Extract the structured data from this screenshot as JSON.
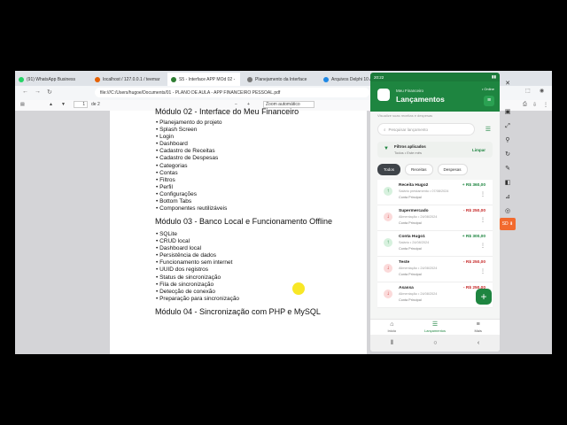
{
  "browser": {
    "tabs": [
      {
        "label": "(91) WhatsApp Business",
        "color": "#25d366"
      },
      {
        "label": "localhost / 127.0.0.1 / teemar",
        "color": "#e66000"
      },
      {
        "label": "S5 - Interface APP MOd 02 -",
        "color": "#2e7d32"
      },
      {
        "label": "Planejamento da Interface",
        "color": "#777777"
      },
      {
        "label": "Arquivos Delphi 10 Avanc",
        "color": "#1e88e5"
      }
    ],
    "url": "file:///C:/Users/hugoe/Documents/01 - PLANO DE AULA - APP FINANCEIRO PESSOAL.pdf",
    "page_current": "1",
    "page_total": "de 2",
    "zoom": "Zoom automático"
  },
  "pdf": {
    "heading1": "Módulo 02 - Interface do Meu Financeiro",
    "list1": [
      "• Planejamento do projeto",
      "• Splash Screen",
      "• Login",
      "• Dashboard",
      "• Cadastro de Receitas",
      "• Cadastro de Despesas",
      "• Categorias",
      "• Contas",
      "• Filtros",
      "• Perfil",
      "• Configurações",
      "• Bottom Tabs",
      "• Componentes reutilizáveis"
    ],
    "heading2": "Módulo 03 - Banco Local e Funcionamento Offline",
    "list2": [
      "• SQLite",
      "• CRUD local",
      "• Dashboard local",
      "• Persistência de dados",
      "• Funcionamento sem internet",
      "• UUID dos registros",
      "• Status de sincronização",
      "• Fila de sincronização",
      "• Detecção de conexão",
      "• Preparação para sincronização"
    ],
    "heading3": "Módulo 04 - Sincronização com PHP e MySQL"
  },
  "app": {
    "status_time": "20:22",
    "subtitle": "Meu Financeiro",
    "title": "Lançamentos",
    "online": "• Online",
    "section_hint": "Visualize suas receitas e despesas",
    "search_placeholder": "Pesquisar lançamento",
    "filter_title": "Filtros aplicados",
    "filter_sub": "Todos • Este mês",
    "filter_clear": "Limpar",
    "tabs": [
      "Todos",
      "Receitas",
      "Despesas"
    ],
    "items": [
      {
        "name": "Receita Hugo2",
        "desc": "Salário prestamento • 07/08/2024",
        "account": "Conta Principal",
        "value": "+ R$ 360,00",
        "type": "in"
      },
      {
        "name": "Supermercado",
        "desc": "Alimentação • 24/08/2024",
        "account": "Conta Principal",
        "value": "- R$ 250,00",
        "type": "out"
      },
      {
        "name": "Conta Hugo1",
        "desc": "Salário • 24/08/2024",
        "account": "Conta Principal",
        "value": "+ R$ 300,00",
        "type": "in"
      },
      {
        "name": "Teste",
        "desc": "Alimentação • 24/08/2024",
        "account": "Conta Principal",
        "value": "- R$ 250,00",
        "type": "out"
      },
      {
        "name": "Asassa",
        "desc": "Alimentação • 24/08/2024",
        "account": "Conta Principal",
        "value": "- R$ 250,00",
        "type": "out"
      }
    ],
    "bottom_nav": [
      "Início",
      "Lançamentos",
      "Mais"
    ],
    "accent": "#1e8540"
  },
  "emulator": {
    "sd_label": "SD"
  }
}
